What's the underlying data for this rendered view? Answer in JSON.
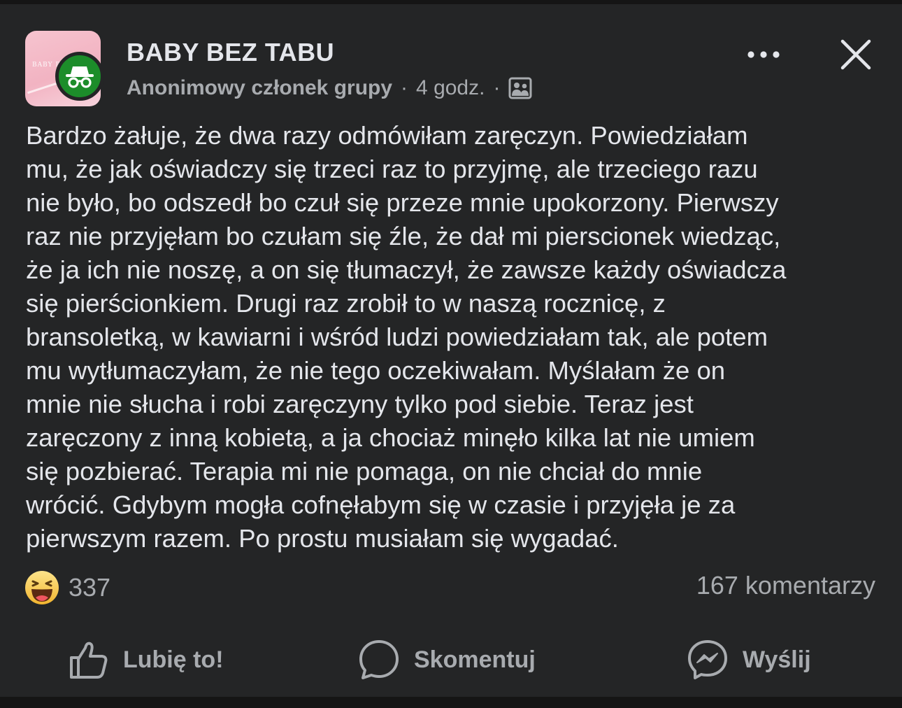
{
  "header": {
    "group_name": "BABY BEZ TABU",
    "group_thumb_text": "BABY B",
    "author": "Anonimowy członek grupy",
    "separator": "·",
    "time": "4 godz.",
    "icons": {
      "anonymous": "incognito-icon",
      "audience": "group-members-icon",
      "more": "more-options-icon",
      "close": "close-icon"
    }
  },
  "post": {
    "lines": [
      "Bardzo żałuje, że dwa razy odmówiłam zaręczyn. Powiedziałam",
      "mu, że jak oświadczy się trzeci raz to przyjmę, ale trzeciego razu",
      "nie było, bo odszedł bo czuł się przeze mnie upokorzony. Pierwszy",
      "raz nie przyjęłam bo czułam się źle, że dał mi pierscionek wiedząc,",
      "że ja ich nie noszę, a on się tłumaczył, że zawsze każdy oświadcza",
      "się pierścionkiem. Drugi raz zrobił to w naszą rocznicę, z",
      "bransoletką, w kawiarni i wśród ludzi powiedziałam tak, ale potem",
      "mu wytłumaczyłam, że nie tego oczekiwałam. Myślałam że on",
      "mnie nie słucha i robi zaręczyny tylko pod siebie. Teraz jest",
      "zaręczony z inną kobietą, a ja chociaż minęło kilka lat nie umiem",
      "się pozbierać. Terapia mi nie pomaga, on nie chciał do mnie",
      "wrócić. Gdybym mogła cofnęłabym się w czasie i przyjęła je za",
      "pierwszym razem. Po prostu musiałam się wygadać."
    ]
  },
  "stats": {
    "reaction_icon": "haha-reaction-icon",
    "reaction_count": "337",
    "comments": "167 komentarzy"
  },
  "actions": {
    "like": {
      "label": "Lubię to!",
      "icon": "thumbs-up-icon"
    },
    "comment": {
      "label": "Skomentuj",
      "icon": "comment-bubble-icon"
    },
    "share": {
      "label": "Wyślij",
      "icon": "messenger-icon"
    }
  },
  "colors": {
    "background": "#242526",
    "text_primary": "#e4e6eb",
    "text_secondary": "#a8abaf",
    "anon_badge": "#1c8d2a",
    "group_thumb": "#f2b3c2",
    "reaction_yellow": "#f7c948"
  }
}
